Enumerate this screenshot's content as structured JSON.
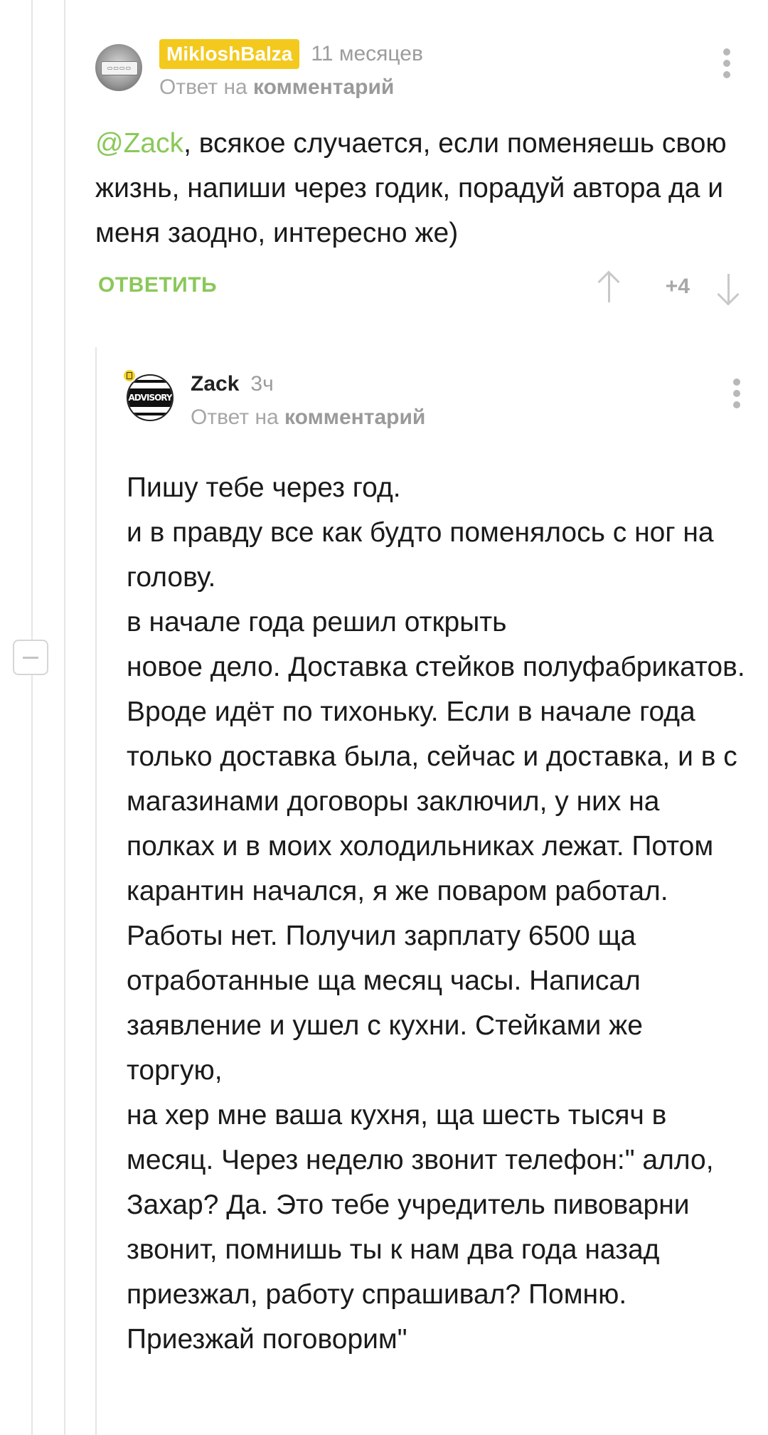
{
  "comments": [
    {
      "username": "MikloshBalza",
      "time": "11 месяцев",
      "reply_prefix": "Ответ на",
      "reply_link": "комментарий",
      "mention": "@Zack",
      "text": ", всякое случается, если поменяешь свою жизнь, напиши через годик, порадуй автора да и меня заодно, интересно же)",
      "reply_label": "ОТВЕТИТЬ",
      "score": "+4",
      "avatar_icon": "car-plate-avatar"
    },
    {
      "username": "Zack",
      "time": "3ч",
      "reply_prefix": "Ответ на",
      "reply_link": "комментарий",
      "avatar_text": "ADVISORY",
      "avatar_icon": "parental-advisory-avatar",
      "text": "Пишу тебе через год.\nи в правду все как будто поменялось с ног на голову.\nв начале года решил открыть\nновое дело. Доставка стейков полуфабрикатов. Вроде идёт по тихоньку. Если в начале года только доставка была, сейчас и доставка, и в с магазинами договоры заключил, у них на полках и в моих холодильниках лежат. Потом карантин начался, я же поваром работал. Работы нет. Получил зарплату 6500 ща отработанные ща месяц часы. Написал заявление и ушел с кухни. Стейками же торгую,\nна хер мне ваша кухня, ща шесть тысяч в месяц. Через неделю звонит телефон:\" алло, Захар? Да. Это тебе учредитель пивоварни звонит, помнишь ты к нам два года назад приезжал, работу спрашивал? Помню. Приезжай поговорим\""
    }
  ],
  "colors": {
    "username_badge": "#f4c91e",
    "accent_green": "#8ac858",
    "muted_gray": "#a6a6a6"
  }
}
